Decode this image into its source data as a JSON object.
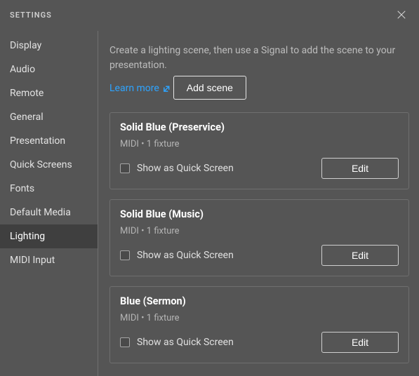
{
  "window": {
    "title": "SETTINGS"
  },
  "sidebar": {
    "items": [
      {
        "label": "Display",
        "active": false
      },
      {
        "label": "Audio",
        "active": false
      },
      {
        "label": "Remote",
        "active": false
      },
      {
        "label": "General",
        "active": false
      },
      {
        "label": "Presentation",
        "active": false
      },
      {
        "label": "Quick Screens",
        "active": false
      },
      {
        "label": "Fonts",
        "active": false
      },
      {
        "label": "Default Media",
        "active": false
      },
      {
        "label": "Lighting",
        "active": true
      },
      {
        "label": "MIDI Input",
        "active": false
      }
    ]
  },
  "content": {
    "intro": "Create a lighting scene, then use a Signal to add the scene to your presentation.",
    "learnMore": "Learn more",
    "addSceneLabel": "Add scene",
    "checkboxLabel": "Show as Quick Screen",
    "editLabel": "Edit",
    "scenes": [
      {
        "title": "Solid Blue (Preservice)",
        "meta": "MIDI  •  1  fixture",
        "checked": false
      },
      {
        "title": "Solid Blue (Music)",
        "meta": "MIDI  •  1  fixture",
        "checked": false
      },
      {
        "title": "Blue (Sermon)",
        "meta": "MIDI  •  1  fixture",
        "checked": false
      }
    ]
  }
}
